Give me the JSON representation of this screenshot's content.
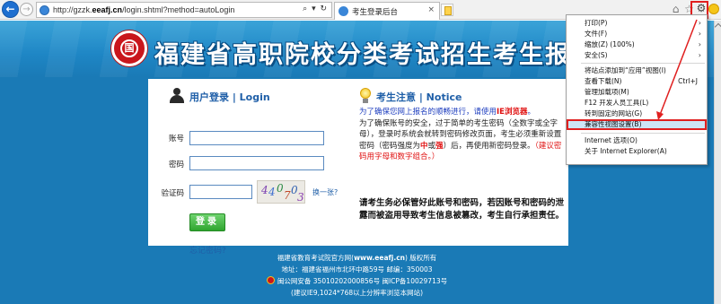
{
  "browser": {
    "url_host": "http://gzzk.",
    "url_domain": "eeafj.cn",
    "url_path": "/login.shtml?method=autoLogin",
    "addr_buttons": "⌕ ▾ ↻",
    "tab_title": "考生登录后台",
    "tab_close": "×",
    "back": "←",
    "forward": "→",
    "home_icon": "⌂",
    "star_icon": "☆",
    "gear_icon": "⚙"
  },
  "header": {
    "emblem_text": "国",
    "title": "福建省高职院校分类考试招生考生报名系统"
  },
  "login": {
    "title": "用户登录 | Login",
    "account_label": "账号",
    "password_label": "密码",
    "captcha_label": "验证码",
    "captcha_text": [
      "4",
      "4",
      "0",
      "7",
      "0",
      "3"
    ],
    "captcha_refresh": "换一张?",
    "login_button": "登录",
    "forgot_password": "忘记密码?"
  },
  "notice": {
    "title": "考生注意 | Notice",
    "p1_a": "为了确保您网上报名的顺畅进行，请使用",
    "p1_b": "IE浏览器",
    "p1_c": "。",
    "p2_a": "为了确保账号的安全，过于简单的考生密码（全数字或全字母），登录时系统会就转到密码修改页面，考生必须重新设置密码（密码强度为",
    "p2_mid": "中",
    "p2_or": "或",
    "p2_strong": "强",
    "p2_b": "）后，再使用新密码登录。",
    "p2_c": "（建议密码用字母和数字组合。）",
    "warning": "请考生务必保管好此账号和密码，若因账号和密码的泄露而被盗用导致考生信息被篡改，考生自行承担责任。"
  },
  "footer": {
    "line1_a": "福建省教育考试院官方网(",
    "line1_link": "www.eeafj.cn",
    "line1_b": ") 版权所有",
    "line2": "地址：福建省福州市北环中路59号 邮编：350003",
    "line3": "闽公网安备 35010202000856号 闽ICP备10029713号",
    "line4": "(建议IE9,1024*768以上分辨率浏览本网站)"
  },
  "menu": {
    "items": [
      {
        "label": "打印(P)",
        "arrow": "›"
      },
      {
        "label": "文件(F)",
        "arrow": "›"
      },
      {
        "label": "缩放(Z) (100%)",
        "arrow": "›"
      },
      {
        "label": "安全(S)",
        "arrow": "›"
      },
      {
        "label": "将站点添加到“应用”视图(I)"
      },
      {
        "label": "查看下载(N)",
        "shortcut": "Ctrl+J"
      },
      {
        "label": "管理加载项(M)"
      },
      {
        "label": "F12 开发人员工具(L)"
      },
      {
        "label": "转到固定的网站(G)"
      },
      {
        "label": "兼容性视图设置(B)"
      },
      {
        "label": "Internet 选项(O)"
      },
      {
        "label": "关于 Internet Explorer(A)"
      }
    ]
  },
  "colors": {
    "page_background": "#1a7ab6",
    "link_blue": "#1f5fa8",
    "highlight_red": "#e02020",
    "login_green": "#2fa52f"
  }
}
